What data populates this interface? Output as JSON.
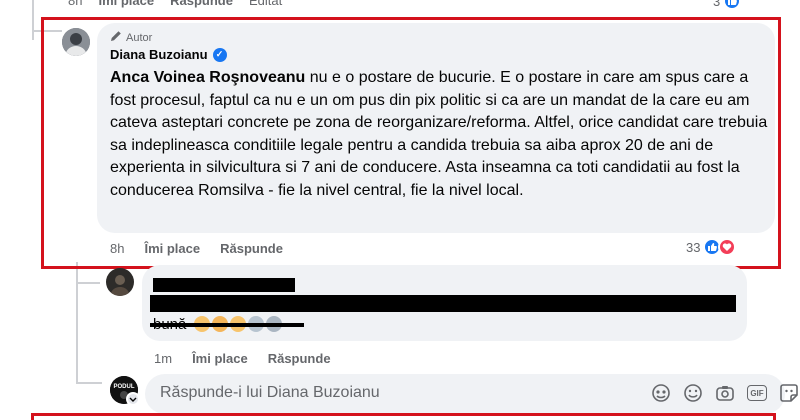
{
  "top_row": {
    "time": "8h",
    "like_label": "Îmi place",
    "reply_label": "Răspunde",
    "edited_label": "Editat",
    "reaction_count": "3"
  },
  "main_comment": {
    "author_badge": "Autor",
    "author_name": "Diana Buzoianu",
    "mention": "Anca Voinea Roşnoveanu",
    "text": " nu e o postare de bucurie. E o postare in care am spus care a fost procesul, faptul ca nu e un om pus din pix politic si ca are un mandat de la care eu am cateva asteptari concrete pe zona de reorganizare/reforma. Altfel, orice candidat care trebuia sa indeplineasca conditiile legale pentru a candida trebuia sa aiba aprox 20 de ani de experienta in silvicultura si 7 ani de conducere. Asta inseamna ca toti candidatii au fost la conducerea Romsilva - fie la nivel central, fie la nivel local.",
    "time": "8h",
    "like_label": "Îmi place",
    "reply_label": "Răspunde",
    "reaction_count": "33"
  },
  "reply_comment": {
    "visible_text_fragment": "bună",
    "time": "1m",
    "like_label": "Îmi place",
    "reply_label": "Răspunde"
  },
  "reply_input": {
    "placeholder": "Răspunde-i lui Diana Buzoianu",
    "avatar_label": "PODUL"
  },
  "icons": {
    "pencil": "pencil-icon",
    "verified": "verified-badge-icon",
    "like": "like-reaction-icon",
    "love": "love-reaction-icon",
    "avatar_mask": "avatar-mask-icon",
    "emoji": "emoji-icon",
    "camera": "camera-icon",
    "gif": "gif-icon",
    "sticker": "sticker-icon"
  },
  "colors": {
    "highlight": "#d4121c",
    "bubble": "#f0f2f5",
    "secondary_text": "#65676b",
    "like_blue": "#1877f2",
    "love_red": "#f33e58"
  }
}
